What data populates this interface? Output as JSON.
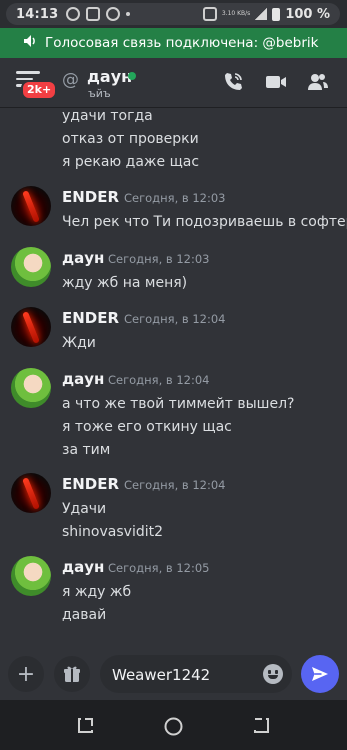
{
  "status_bar": {
    "time": "14:13",
    "net_speed": "3.10 KB/s",
    "battery": "100 %"
  },
  "voice_banner": {
    "text": "Голосовая связь подключена: @bebrik"
  },
  "header": {
    "badge": "2k+",
    "at_symbol": "@",
    "channel_name": "даун",
    "status_text": "ъйъ",
    "online_color": "#23a55a",
    "icons": [
      "menu-icon",
      "voice-call-icon",
      "video-call-icon",
      "members-icon"
    ]
  },
  "messages": {
    "continuation": [
      "удачи тогда",
      "отказ от проверки",
      "я рекаю даже щас"
    ],
    "groups": [
      {
        "author": "ENDER",
        "timestamp": "Сегодня, в 12:03",
        "lines": [
          "Чел рек что Ти подозриваешь в софтер"
        ]
      },
      {
        "author": "даун",
        "timestamp": "Сегодня, в 12:03",
        "lines": [
          "жду жб на меня)"
        ]
      },
      {
        "author": "ENDER",
        "timestamp": "Сегодня, в 12:04",
        "lines": [
          "Жди"
        ]
      },
      {
        "author": "даун",
        "timestamp": "Сегодня, в 12:04",
        "lines": [
          "а что же твой тиммейт вышел?",
          "я тоже его откину щас",
          "за тим"
        ]
      },
      {
        "author": "ENDER",
        "timestamp": "Сегодня, в 12:04",
        "lines": [
          "Удачи",
          "shinovasvidit2"
        ]
      },
      {
        "author": "даун",
        "timestamp": "Сегодня, в 12:05",
        "lines": [
          "я жду жб",
          "давай"
        ]
      }
    ]
  },
  "composer": {
    "input_value": "Weawer1242",
    "plus_label": "+",
    "accent": "#5865f2"
  }
}
